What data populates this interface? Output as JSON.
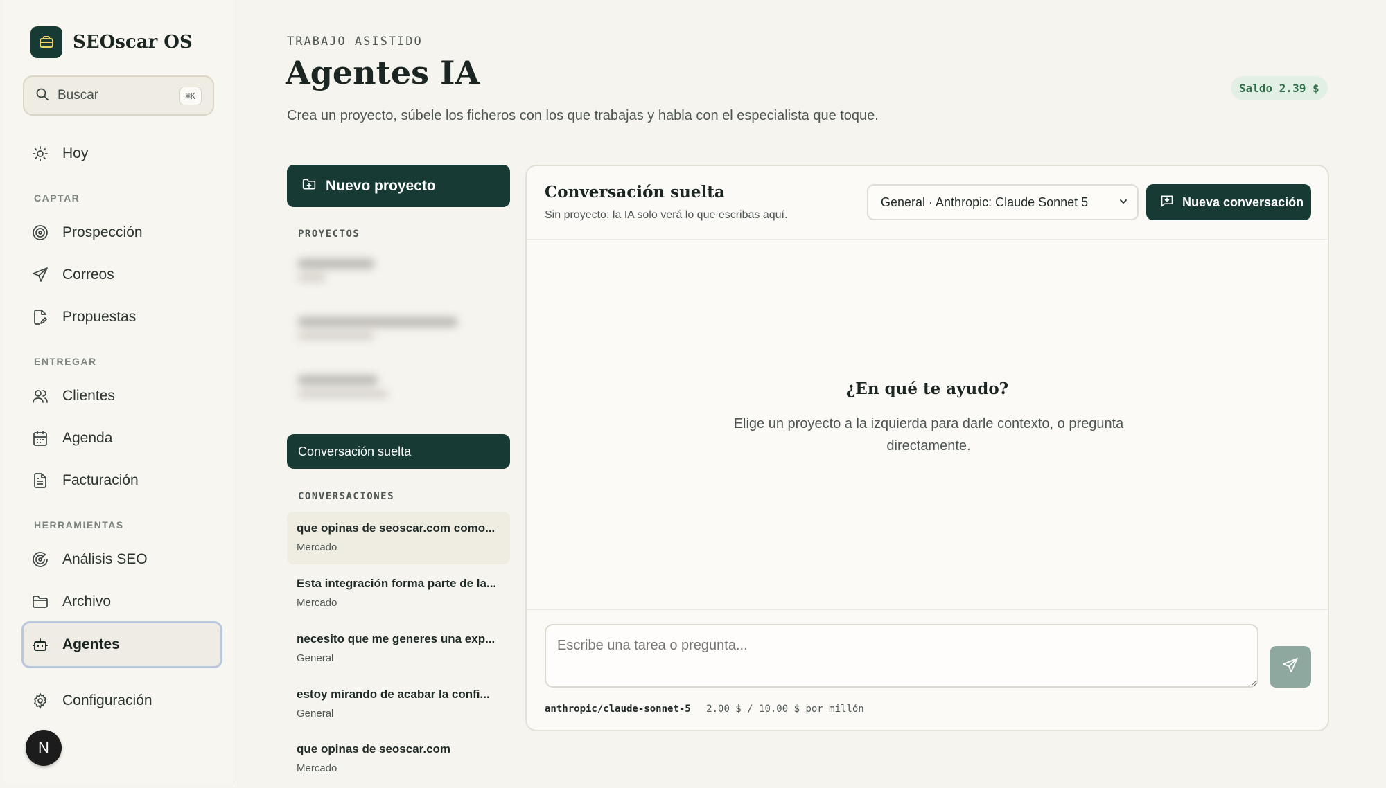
{
  "app": {
    "name": "SEOscar OS"
  },
  "search": {
    "label": "Buscar",
    "shortcut": "⌘K"
  },
  "sidebar": {
    "today": "Hoy",
    "sections": [
      "CAPTAR",
      "ENTREGAR",
      "HERRAMIENTAS"
    ],
    "items": [
      {
        "label": "Prospección",
        "icon": "target-icon"
      },
      {
        "label": "Correos",
        "icon": "send-icon"
      },
      {
        "label": "Propuestas",
        "icon": "document-edit-icon"
      },
      {
        "label": "Clientes",
        "icon": "users-icon"
      },
      {
        "label": "Agenda",
        "icon": "calendar-icon"
      },
      {
        "label": "Facturación",
        "icon": "invoice-icon"
      },
      {
        "label": "Análisis SEO",
        "icon": "radar-icon"
      },
      {
        "label": "Archivo",
        "icon": "folder-icon"
      },
      {
        "label": "Agentes",
        "icon": "robot-icon",
        "active": true
      }
    ],
    "settings": "Configuración",
    "avatar": "N"
  },
  "header": {
    "eyebrow": "TRABAJO ASISTIDO",
    "title": "Agentes IA",
    "description": "Crea un proyecto, súbele los ficheros con los que trabajas y habla con el especialista que toque.",
    "balance": "Saldo 2.39 $"
  },
  "projects": {
    "new_button": "Nuevo proyecto",
    "section_label": "PROYECTOS",
    "loose_button": "Conversación suelta"
  },
  "conversations": {
    "section_label": "CONVERSACIONES",
    "items": [
      {
        "title": "que opinas de seoscar.com como...",
        "agent": "Mercado",
        "selected": true
      },
      {
        "title": "Esta integración forma parte de la...",
        "agent": "Mercado"
      },
      {
        "title": "necesito que me generes una exp...",
        "agent": "General"
      },
      {
        "title": "estoy mirando de acabar la confi...",
        "agent": "General"
      },
      {
        "title": "que opinas de seoscar.com",
        "agent": "Mercado"
      }
    ]
  },
  "chat": {
    "title": "Conversación suelta",
    "subtitle": "Sin proyecto: la IA solo verá lo que escribas aquí.",
    "model_selected": "General · Anthropic: Claude Sonnet 5",
    "new_conversation": "Nueva conversación",
    "empty_title": "¿En qué te ayudo?",
    "empty_desc": "Elige un proyecto a la izquierda para darle contexto, o pregunta directamente.",
    "input_placeholder": "Escribe una tarea o pregunta...",
    "model_id": "anthropic/claude-sonnet-5",
    "model_price": "2.00 $ / 10.00 $ por millón"
  },
  "colors": {
    "accent": "#173a35",
    "background": "#f6f4ee",
    "balance_bg": "#e2efe4",
    "balance_text": "#2f6b46"
  }
}
